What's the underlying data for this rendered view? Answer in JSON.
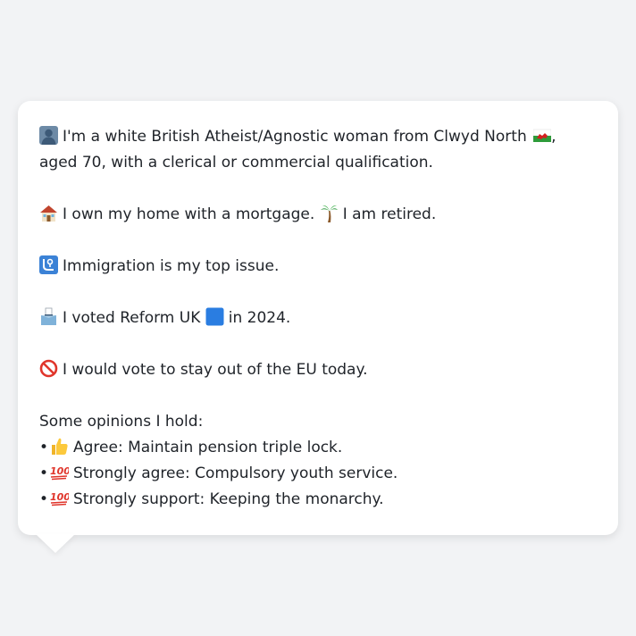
{
  "persona": {
    "intro": "I'm a white British Atheist/Agnostic woman from Clwyd North",
    "intro_tail": ", aged 70, with a clerical or commercial qualification.",
    "home": "I own my home with a mortgage.",
    "work": "I am retired.",
    "issue": "Immigration is my top issue.",
    "vote_pre": "I voted Reform UK",
    "vote_post": "in 2024.",
    "eu": "I would vote to stay out of the EU today.",
    "opinions_header": "Some opinions I hold:",
    "opinions": [
      {
        "bullet": "•",
        "icon": "thumbs-up-icon",
        "text": "Agree: Maintain pension triple lock."
      },
      {
        "bullet": "•",
        "icon": "hundred-points-icon",
        "text": "Strongly agree: Compulsory youth service."
      },
      {
        "bullet": "•",
        "icon": "hundred-points-icon",
        "text": "Strongly support: Keeping the monarchy."
      }
    ]
  },
  "colors": {
    "background": "#f2f3f5",
    "card": "#ffffff",
    "text": "#1f2329",
    "reform_square": "#2a7de1",
    "no_entry": "#e0352b",
    "hundred": "#e0352b"
  },
  "icons": {
    "person": "bust-silhouette-icon",
    "flag": "wales-flag-icon",
    "home": "house-icon",
    "palm": "palm-tree-icon",
    "issue": "passport-control-icon",
    "ballot": "ballot-box-icon",
    "party": "blue-square-icon",
    "eu": "no-entry-icon"
  }
}
